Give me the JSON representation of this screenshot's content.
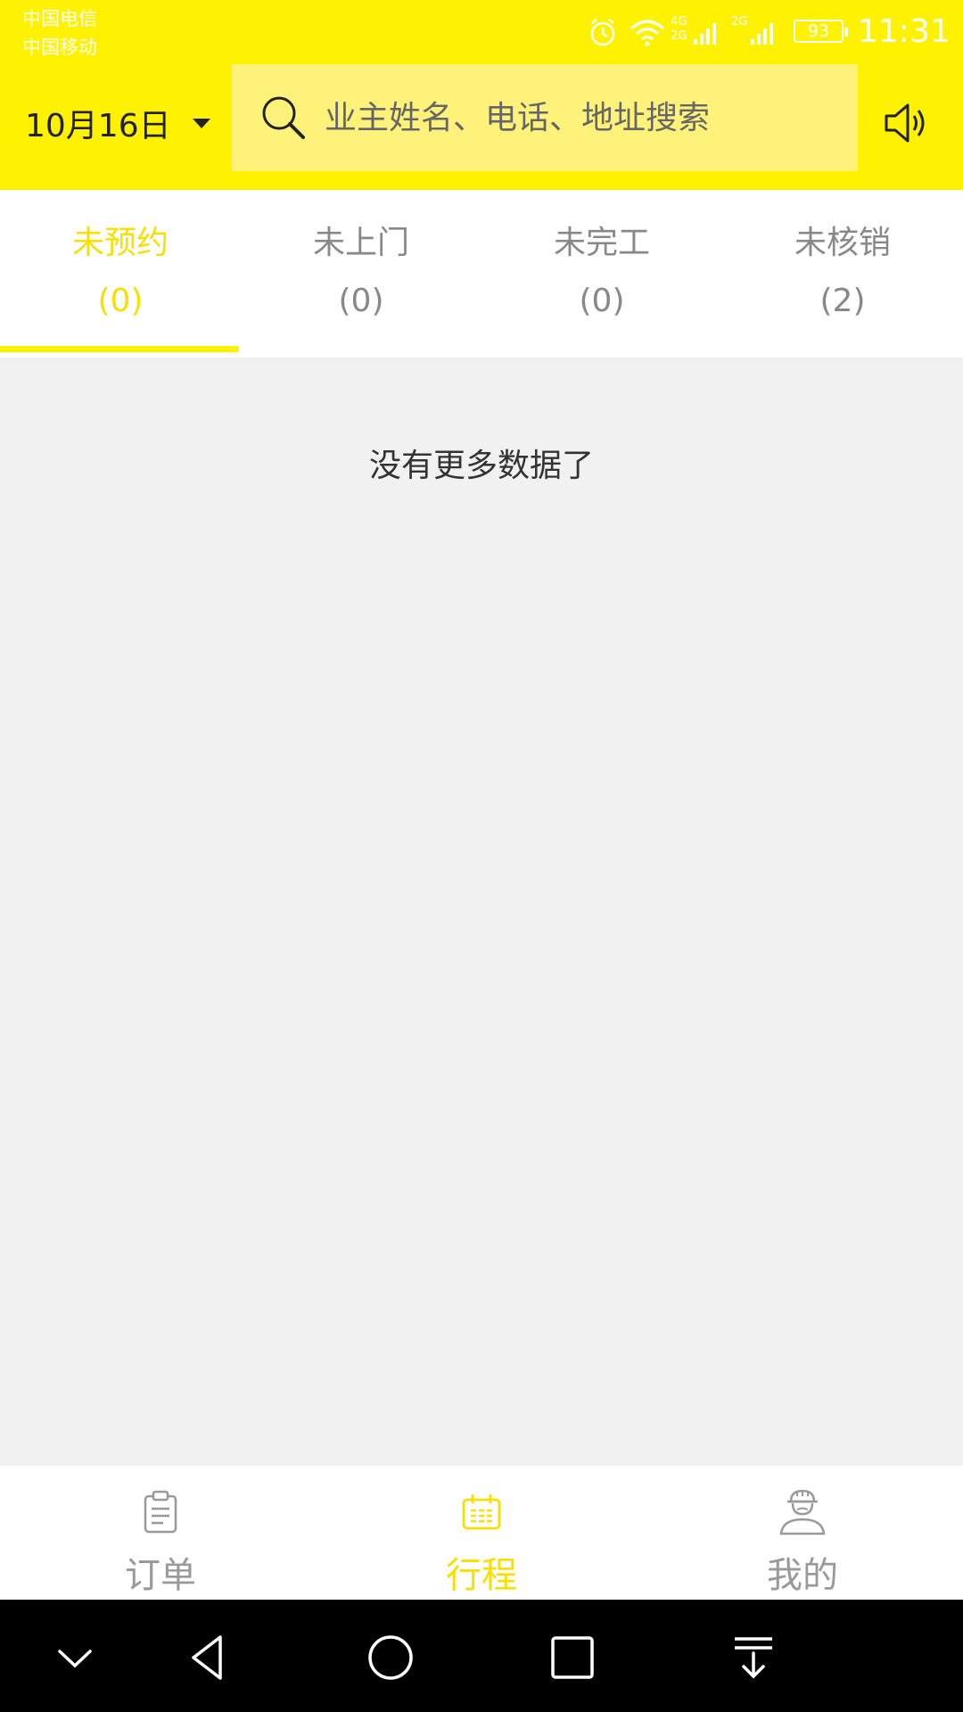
{
  "status_bar": {
    "carrier_1": "中国电信",
    "carrier_2": "中国移动",
    "network_1": "4G",
    "network_1b": "2G",
    "network_2": "2G",
    "battery": "93",
    "time": "11:31"
  },
  "header": {
    "date": "10月16日",
    "search_placeholder": "业主姓名、电话、地址搜索"
  },
  "tabs": [
    {
      "label": "未预约",
      "count": "(0)",
      "active": true
    },
    {
      "label": "未上门",
      "count": "(0)",
      "active": false
    },
    {
      "label": "未完工",
      "count": "(0)",
      "active": false
    },
    {
      "label": "未核销",
      "count": "(2)",
      "active": false
    }
  ],
  "content": {
    "empty_message": "没有更多数据了"
  },
  "bottom_nav": [
    {
      "label": "订单",
      "icon": "clipboard-icon",
      "active": false
    },
    {
      "label": "行程",
      "icon": "calendar-icon",
      "active": true
    },
    {
      "label": "我的",
      "icon": "worker-profile-icon",
      "active": false
    }
  ],
  "colors": {
    "brand_yellow": "#fff200",
    "search_bg": "#fff27a",
    "active_text": "#f5e000",
    "inactive_text": "#888888",
    "content_bg": "#f1f1f1"
  }
}
